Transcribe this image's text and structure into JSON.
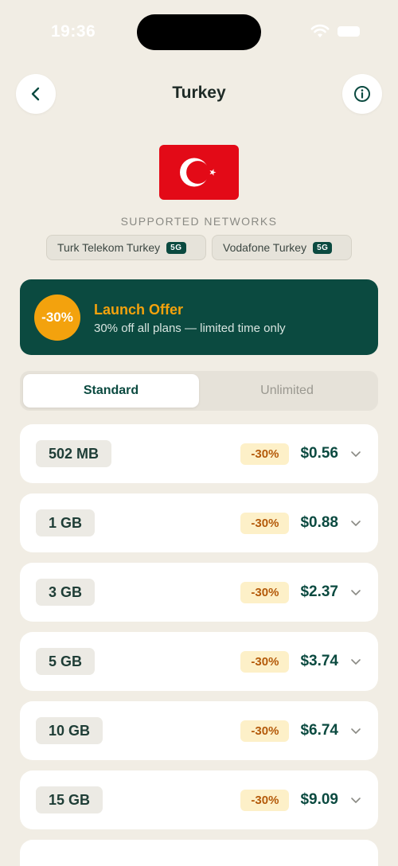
{
  "status": {
    "time": "19:36"
  },
  "header": {
    "title": "Turkey"
  },
  "networks": {
    "label": "SUPPORTED NETWORKS",
    "items": [
      {
        "name": "Turk Telekom Turkey",
        "tag": "5G"
      },
      {
        "name": "Vodafone Turkey",
        "tag": "5G"
      }
    ]
  },
  "offer": {
    "badge": "-30%",
    "title": "Launch Offer",
    "subtitle": "30% off all plans — limited time only"
  },
  "tabs": [
    {
      "label": "Standard",
      "selected": true
    },
    {
      "label": "Unlimited",
      "selected": false
    }
  ],
  "plans": [
    {
      "size": "502 MB",
      "discount": "-30%",
      "price": "$0.56"
    },
    {
      "size": "1 GB",
      "discount": "-30%",
      "price": "$0.88"
    },
    {
      "size": "3 GB",
      "discount": "-30%",
      "price": "$2.37"
    },
    {
      "size": "5 GB",
      "discount": "-30%",
      "price": "$3.74"
    },
    {
      "size": "10 GB",
      "discount": "-30%",
      "price": "$6.74"
    },
    {
      "size": "15 GB",
      "discount": "-30%",
      "price": "$9.09"
    }
  ],
  "colors": {
    "background": "#f1ede4",
    "accent": "#0b4a40",
    "offer_orange": "#f3a20d",
    "flag_red": "#e30a17"
  }
}
